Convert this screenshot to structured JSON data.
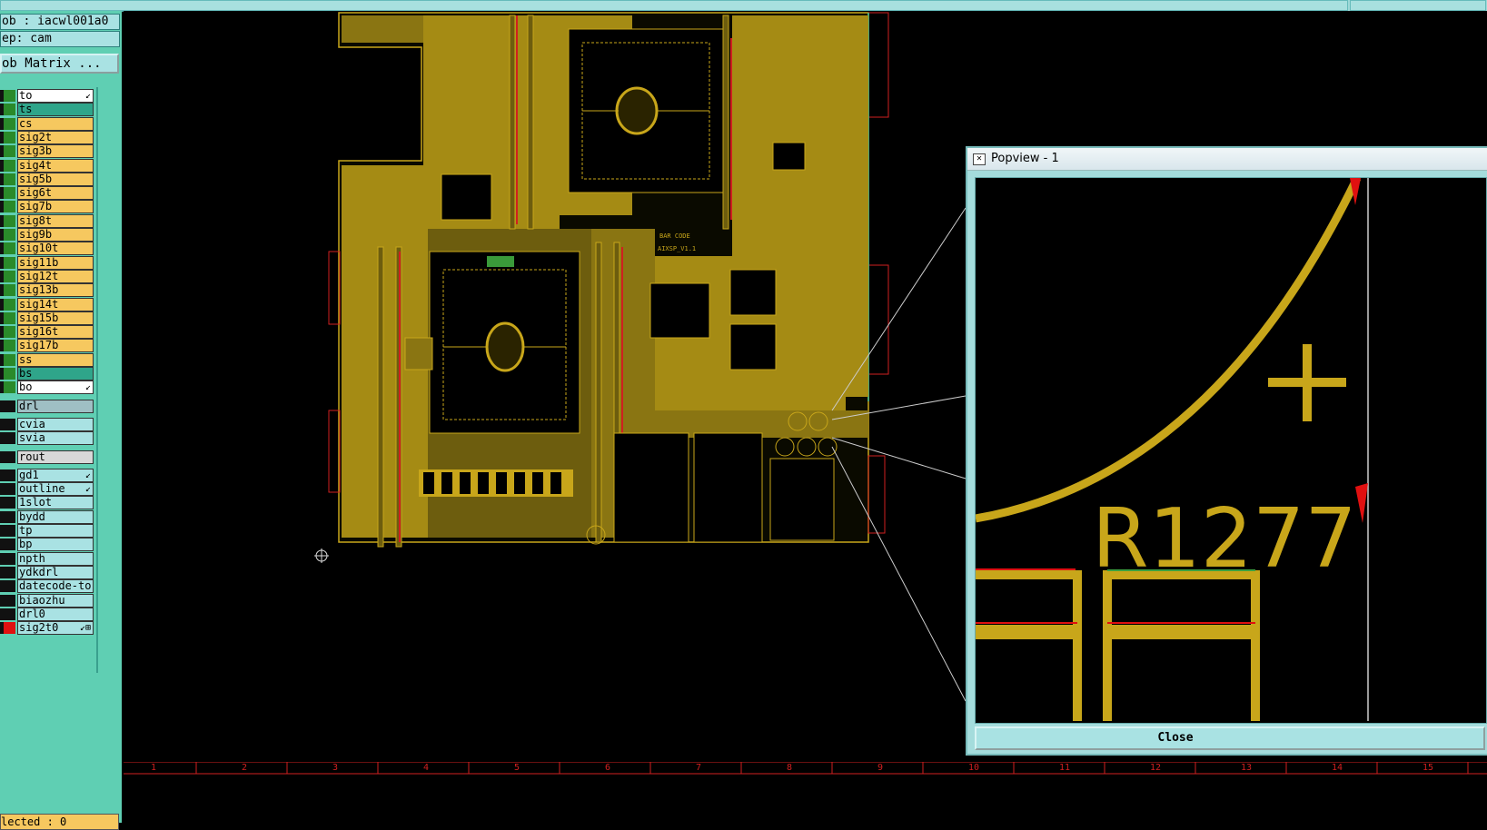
{
  "info": {
    "job": "ob : iacwl001a0",
    "step": "ep: cam",
    "matrix_button": "ob Matrix ..."
  },
  "colors": {
    "panel": "#5fcfb3",
    "copper": "#c8a61a",
    "outline": "#e02020",
    "layer_orange": "#f6c85f",
    "layer_teal": "#2fa58a",
    "layer_cyan": "#a9e2e3"
  },
  "layers": [
    {
      "name": "to",
      "bg": "#ffffff",
      "sw": "#2a8a2a",
      "mark": "↙"
    },
    {
      "name": "ts",
      "bg": "#2fa58a",
      "sw": "#2a8a2a",
      "mark": ""
    },
    {
      "name": "cs",
      "bg": "#f6c85f",
      "sw": "#2a8a2a",
      "mark": ""
    },
    {
      "name": "sig2t",
      "bg": "#f6c85f",
      "sw": "#2a8a2a",
      "mark": ""
    },
    {
      "name": "sig3b",
      "bg": "#f6c85f",
      "sw": "#2a8a2a",
      "mark": ""
    },
    {
      "name": "sig4t",
      "bg": "#f6c85f",
      "sw": "#2a8a2a",
      "mark": ""
    },
    {
      "name": "sig5b",
      "bg": "#f6c85f",
      "sw": "#2a8a2a",
      "mark": ""
    },
    {
      "name": "sig6t",
      "bg": "#f6c85f",
      "sw": "#2a8a2a",
      "mark": ""
    },
    {
      "name": "sig7b",
      "bg": "#f6c85f",
      "sw": "#2a8a2a",
      "mark": ""
    },
    {
      "name": "sig8t",
      "bg": "#f6c85f",
      "sw": "#2a8a2a",
      "mark": ""
    },
    {
      "name": "sig9b",
      "bg": "#f6c85f",
      "sw": "#2a8a2a",
      "mark": ""
    },
    {
      "name": "sig10t",
      "bg": "#f6c85f",
      "sw": "#2a8a2a",
      "mark": ""
    },
    {
      "name": "sig11b",
      "bg": "#f6c85f",
      "sw": "#2a8a2a",
      "mark": ""
    },
    {
      "name": "sig12t",
      "bg": "#f6c85f",
      "sw": "#2a8a2a",
      "mark": ""
    },
    {
      "name": "sig13b",
      "bg": "#f6c85f",
      "sw": "#2a8a2a",
      "mark": ""
    },
    {
      "name": "sig14t",
      "bg": "#f6c85f",
      "sw": "#2a8a2a",
      "mark": ""
    },
    {
      "name": "sig15b",
      "bg": "#f6c85f",
      "sw": "#2a8a2a",
      "mark": ""
    },
    {
      "name": "sig16t",
      "bg": "#f6c85f",
      "sw": "#2a8a2a",
      "mark": ""
    },
    {
      "name": "sig17b",
      "bg": "#f6c85f",
      "sw": "#2a8a2a",
      "mark": ""
    },
    {
      "name": "ss",
      "bg": "#f6c85f",
      "sw": "#2a8a2a",
      "mark": ""
    },
    {
      "name": "bs",
      "bg": "#2fa58a",
      "sw": "#2a8a2a",
      "mark": ""
    },
    {
      "name": "bo",
      "bg": "#ffffff",
      "sw": "#2a8a2a",
      "mark": "↙"
    },
    {
      "name": "drl",
      "bg": "#9fbfc4",
      "sw": "#111111",
      "mark": "",
      "gap": true
    },
    {
      "name": "cvia",
      "bg": "#a9e2e3",
      "sw": "#111111",
      "mark": "",
      "gap": true
    },
    {
      "name": "svia",
      "bg": "#a9e2e3",
      "sw": "#111111",
      "mark": ""
    },
    {
      "name": "rout",
      "bg": "#d8d8d8",
      "sw": "#111111",
      "mark": "",
      "gap": true
    },
    {
      "name": "gd1",
      "bg": "#a9e2e3",
      "sw": "#111111",
      "mark": "↙",
      "gap": true
    },
    {
      "name": "outline",
      "bg": "#a9e2e3",
      "sw": "#111111",
      "mark": "↙"
    },
    {
      "name": "1slot",
      "bg": "#a9e2e3",
      "sw": "#111111",
      "mark": ""
    },
    {
      "name": "bydd",
      "bg": "#a9e2e3",
      "sw": "#111111",
      "mark": ""
    },
    {
      "name": "tp",
      "bg": "#a9e2e3",
      "sw": "#111111",
      "mark": ""
    },
    {
      "name": "bp",
      "bg": "#a9e2e3",
      "sw": "#111111",
      "mark": ""
    },
    {
      "name": "npth",
      "bg": "#a9e2e3",
      "sw": "#111111",
      "mark": ""
    },
    {
      "name": "ydkdrl",
      "bg": "#a9e2e3",
      "sw": "#111111",
      "mark": ""
    },
    {
      "name": "datecode-to",
      "bg": "#a9e2e3",
      "sw": "#111111",
      "mark": ""
    },
    {
      "name": "biaozhu",
      "bg": "#a9e2e3",
      "sw": "#111111",
      "mark": ""
    },
    {
      "name": "drl0",
      "bg": "#a9e2e3",
      "sw": "#111111",
      "mark": ""
    },
    {
      "name": "sig2t0",
      "bg": "#a9e2e3",
      "sw": "#e01010",
      "mark": "↙⊞"
    }
  ],
  "status": "lected : 0",
  "board": {
    "barcode_label": "BAR CODE",
    "version_label": "AIXSP_V1.1"
  },
  "ruler_labels": [
    "1",
    "2",
    "3",
    "4",
    "5",
    "6",
    "7",
    "8",
    "9",
    "10",
    "11",
    "12",
    "13",
    "14",
    "15"
  ],
  "popview": {
    "title": "Popview - 1",
    "zoom_text": "R1277",
    "close_label": "Close"
  }
}
